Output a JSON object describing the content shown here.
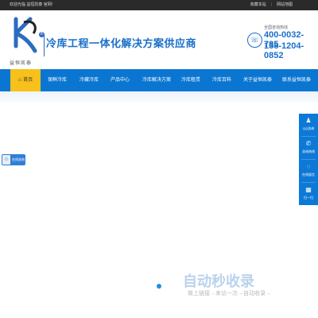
{
  "topbar": {
    "welcome": "欢迎光临 益恒凯泰 官网!",
    "links": [
      "收藏本站",
      "网站地图"
    ]
  },
  "header": {
    "logo_name": "益恒凯泰",
    "reg_mark": "®",
    "slogan": "冷库工程一体化解决方案供应商",
    "phone_label": "全国咨询热线",
    "phone1": "400-0032-785",
    "phone2": "138-1204-0852"
  },
  "nav": {
    "home": "首页",
    "items": [
      "保鲜冷库",
      "冷藏冷库",
      "产品中心",
      "冷库解决方案",
      "冷库租赁",
      "冷库百科",
      "关于益恒凯泰",
      "联系益恒凯泰"
    ]
  },
  "online": {
    "label": "在线咨询"
  },
  "side_panel": {
    "items": [
      {
        "icon": "qq-icon",
        "label": "QQ咨询"
      },
      {
        "icon": "phone-icon",
        "label": "咨询热线"
      },
      {
        "icon": "chat-icon",
        "label": "在线留言"
      },
      {
        "icon": "qrcode-icon",
        "label": "扫一扫"
      }
    ]
  },
  "watermark": {
    "main": "自动秒收录",
    "sub": "做上链接→来访一次→自动收录→"
  },
  "colors": {
    "nav": "#0b76d1",
    "accent": "#f7c01a",
    "brand": "#1a6fc9"
  }
}
